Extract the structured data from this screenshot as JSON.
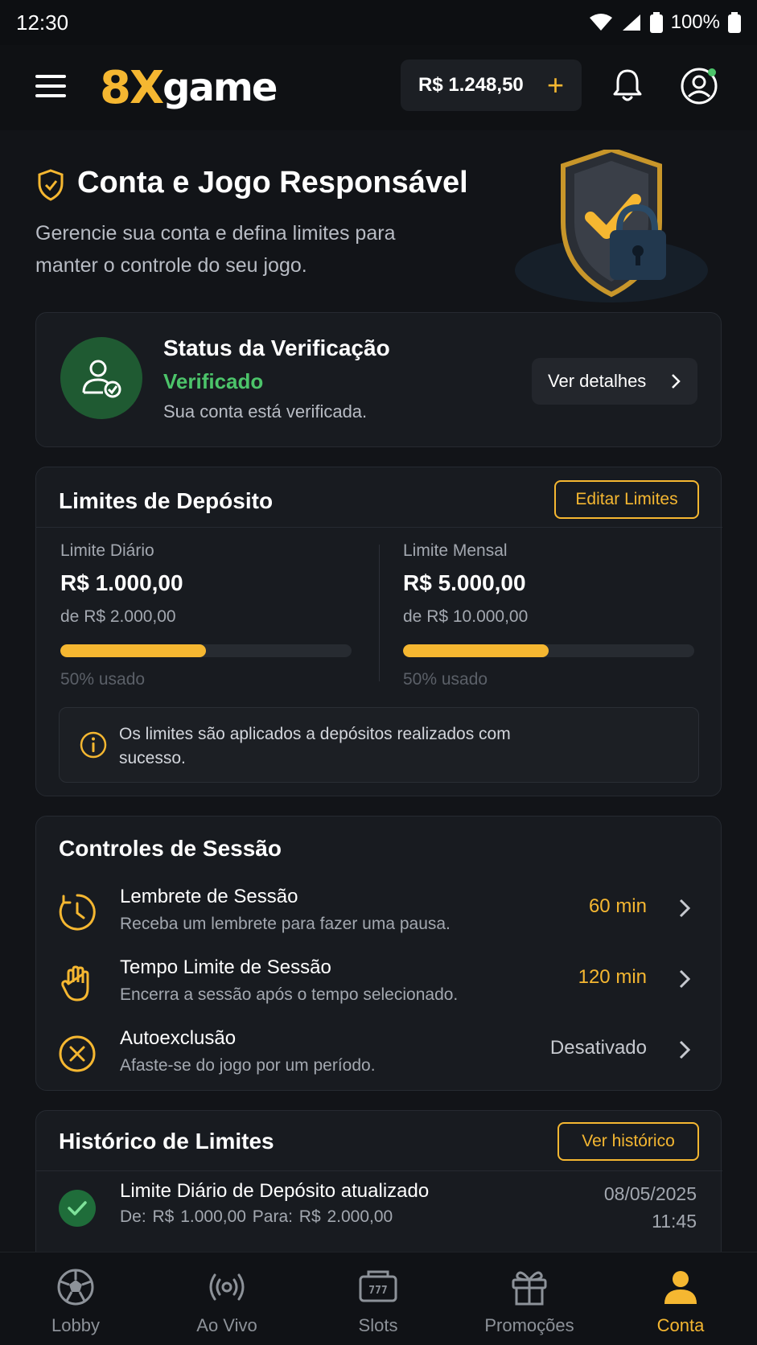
{
  "status_bar": {
    "time": "12:30",
    "battery": "100%"
  },
  "header": {
    "logo_accent": "8X",
    "logo_text": "game",
    "balance": "R$ 1.248,50",
    "add_symbol": "+"
  },
  "hero": {
    "title": "Conta e Jogo Responsável",
    "subtitle": "Gerencie sua conta e defina limites para manter o controle do seu jogo."
  },
  "verification": {
    "title": "Status da Verificação",
    "status": "Verificado",
    "description": "Sua conta está verificada.",
    "button_label": "Ver detalhes"
  },
  "deposit_limits": {
    "title": "Limites de Depósito",
    "edit_label": "Editar Limites",
    "daily": {
      "label": "Limite Diário",
      "value": "R$ 1.000,00",
      "of": "de R$ 2.000,00",
      "used_label": "50% usado",
      "used_fraction": 0.5
    },
    "monthly": {
      "label": "Limite Mensal",
      "value": "R$ 5.000,00",
      "of": "de R$ 10.000,00",
      "used_label": "50% usado",
      "used_fraction": 0.5
    },
    "info": "Os limites são aplicados a depósitos realizados com sucesso."
  },
  "session_controls": {
    "title": "Controles de Sessão",
    "items": [
      {
        "title": "Lembrete de Sessão",
        "description": "Receba um lembrete para fazer uma pausa.",
        "value": "60 min",
        "icon": "clock-icon"
      },
      {
        "title": "Tempo Limite de Sessão",
        "description": "Encerra a sessão após o tempo selecionado.",
        "value": "120 min",
        "icon": "hand-icon"
      },
      {
        "title": "Autoexclusão",
        "description": "Afaste-se do jogo por um período.",
        "value": "Desativado",
        "icon": "x-circle-icon"
      }
    ]
  },
  "limit_history": {
    "title": "Histórico de Limites",
    "button_label": "Ver histórico",
    "entries": [
      {
        "title": "Limite Diário de Depósito atualizado",
        "from": "De: R$ 1.000,00",
        "to": "Para: R$ 2.000,00",
        "date": "08/05/2025",
        "time": "11:45"
      }
    ]
  },
  "bottom_nav": {
    "items": [
      {
        "label": "Lobby",
        "icon": "soccer-ball-icon"
      },
      {
        "label": "Ao Vivo",
        "icon": "broadcast-icon"
      },
      {
        "label": "Slots",
        "icon": "slot-machine-icon"
      },
      {
        "label": "Promoções",
        "icon": "gift-icon"
      },
      {
        "label": "Conta",
        "icon": "user-icon"
      }
    ],
    "active": "Conta"
  },
  "colors": {
    "accent": "#f5b731",
    "success": "#4cc46a",
    "background": "#121418",
    "card": "#181b20"
  }
}
